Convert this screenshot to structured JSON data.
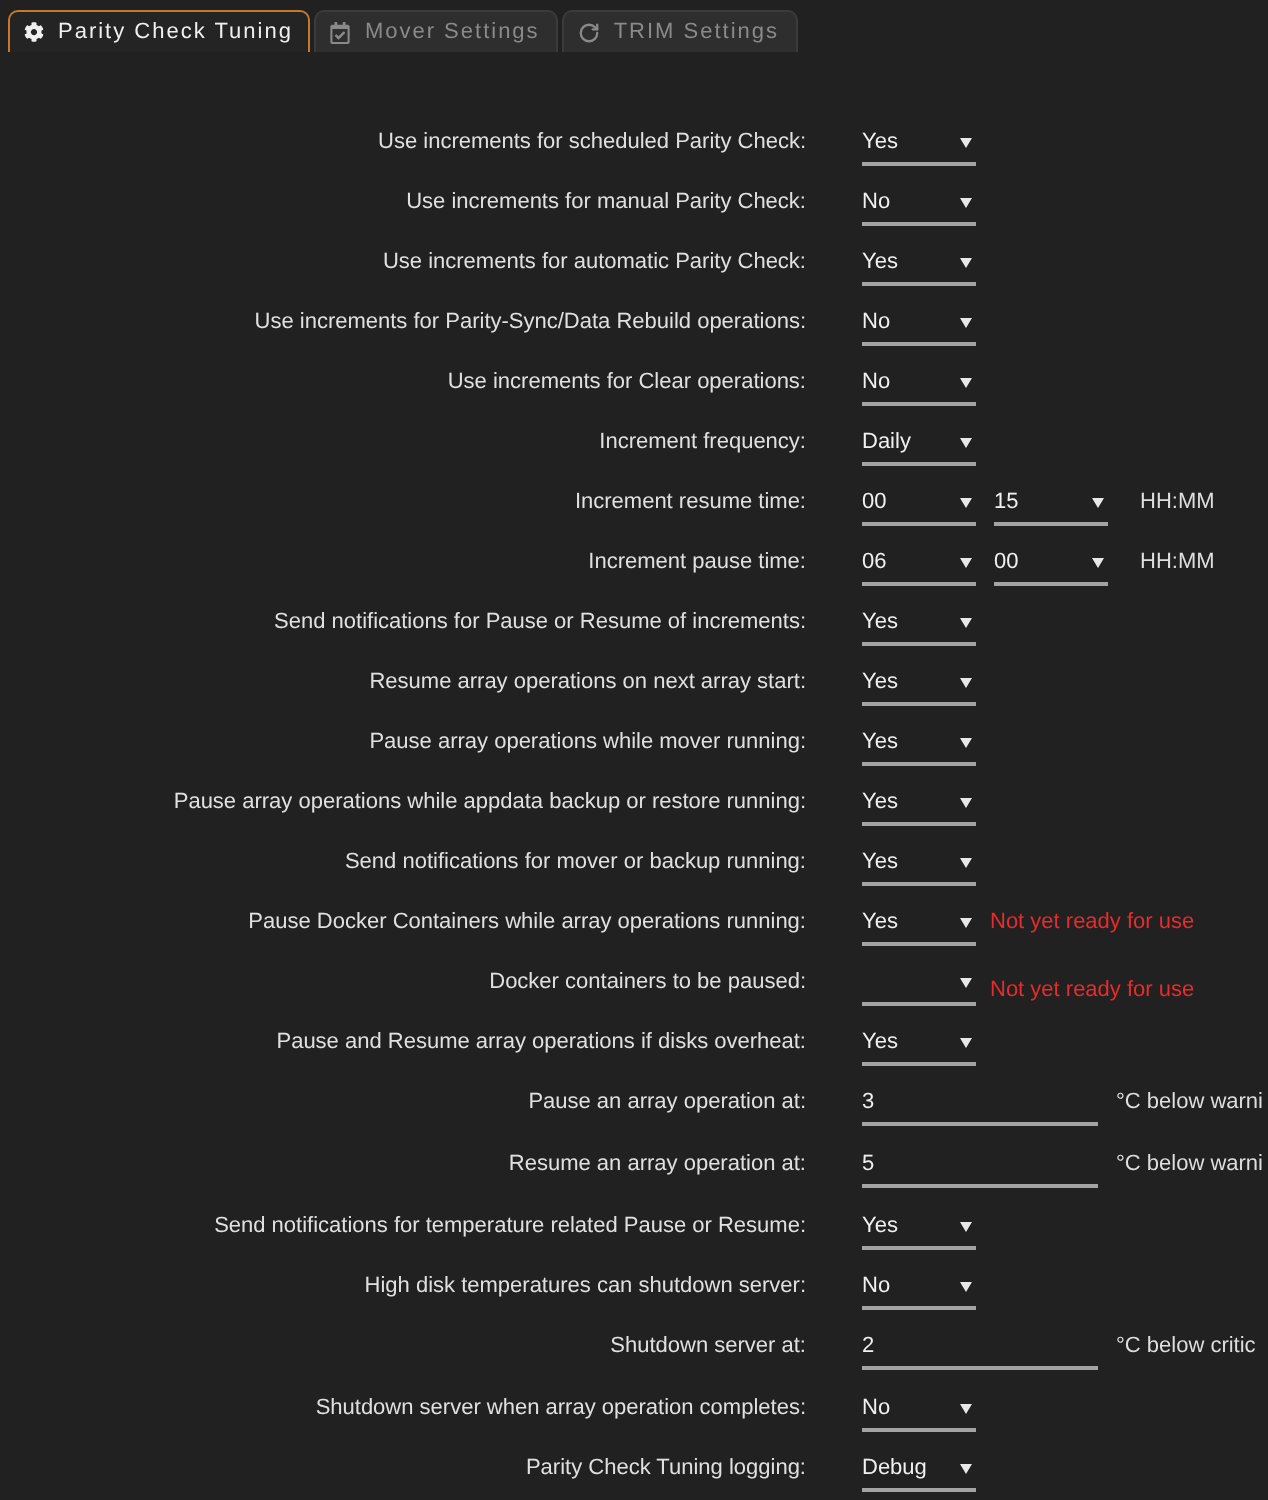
{
  "tabs": [
    {
      "label": "Parity Check Tuning",
      "selected": true
    },
    {
      "label": "Mover Settings",
      "selected": false
    },
    {
      "label": "TRIM Settings",
      "selected": false
    }
  ],
  "settings": [
    {
      "kind": "select",
      "label": "Use increments for scheduled Parity Check:",
      "value": "Yes"
    },
    {
      "kind": "select",
      "label": "Use increments for manual Parity Check:",
      "value": "No"
    },
    {
      "kind": "select",
      "label": "Use increments for automatic Parity Check:",
      "value": "Yes"
    },
    {
      "kind": "select",
      "label": "Use increments for Parity-Sync/Data Rebuild operations:",
      "value": "No"
    },
    {
      "kind": "select",
      "label": "Use increments for Clear operations:",
      "value": "No"
    },
    {
      "kind": "select",
      "label": "Increment frequency:",
      "value": "Daily"
    },
    {
      "kind": "time",
      "label": "Increment resume time:",
      "hours": "00",
      "minutes": "15",
      "unit": "HH:MM"
    },
    {
      "kind": "time",
      "label": "Increment pause time:",
      "hours": "06",
      "minutes": "00",
      "unit": "HH:MM"
    },
    {
      "kind": "select",
      "label": "Send notifications for Pause or Resume of increments:",
      "value": "Yes"
    },
    {
      "kind": "select",
      "label": "Resume array operations on next array start:",
      "value": "Yes"
    },
    {
      "kind": "select",
      "label": "Pause array operations while mover running:",
      "value": "Yes"
    },
    {
      "kind": "select",
      "label": "Pause array operations while appdata backup or restore running:",
      "value": "Yes"
    },
    {
      "kind": "select",
      "label": "Send notifications for mover or backup running:",
      "value": "Yes"
    },
    {
      "kind": "select",
      "label": "Pause Docker Containers while array operations running:",
      "value": "Yes",
      "note": "Not yet ready for use"
    },
    {
      "kind": "select",
      "label": "Docker containers to be paused:",
      "note": "Not yet ready for use"
    },
    {
      "kind": "select",
      "label": "Pause and Resume array operations if disks overheat:",
      "value": "Yes"
    },
    {
      "kind": "number",
      "label": "Pause an array operation at:",
      "value": "3",
      "unit": "°C below warni"
    },
    {
      "kind": "number",
      "label": "Resume an array operation at:",
      "value": "5",
      "unit": "°C below warni"
    },
    {
      "kind": "select",
      "label": "Send notifications for temperature related Pause or Resume:",
      "value": "Yes"
    },
    {
      "kind": "select",
      "label": "High disk temperatures can shutdown server:",
      "value": "No"
    },
    {
      "kind": "number",
      "label": "Shutdown server at:",
      "value": "2",
      "unit": "°C below critic"
    },
    {
      "kind": "select",
      "label": "Shutdown server when array operation completes:",
      "value": "No"
    },
    {
      "kind": "select",
      "label": "Parity Check Tuning logging:",
      "value": "Debug"
    }
  ]
}
